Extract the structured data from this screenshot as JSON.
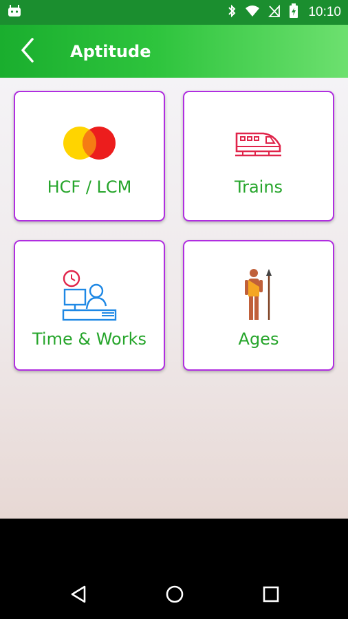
{
  "status_bar": {
    "time": "10:10",
    "icons": [
      "android-icon",
      "bluetooth-icon",
      "wifi-icon",
      "signal-off-icon",
      "battery-charging-icon"
    ]
  },
  "app_bar": {
    "title": "Aptitude",
    "back_icon": "chevron-left-icon",
    "background_colors": [
      "#1aae2e",
      "#6de06f"
    ]
  },
  "grid": {
    "items": [
      {
        "label": "HCF / LCM",
        "icon": "overlapping-circles-icon"
      },
      {
        "label": "Trains",
        "icon": "train-icon"
      },
      {
        "label": "Time & Works",
        "icon": "office-worker-icon"
      },
      {
        "label": "Ages",
        "icon": "tribal-man-icon"
      }
    ],
    "card_border_color": "#b02ee0",
    "label_color": "#26a52b"
  },
  "nav_bar": {
    "buttons": [
      "back-triangle-icon",
      "home-circle-icon",
      "recents-square-icon"
    ]
  }
}
